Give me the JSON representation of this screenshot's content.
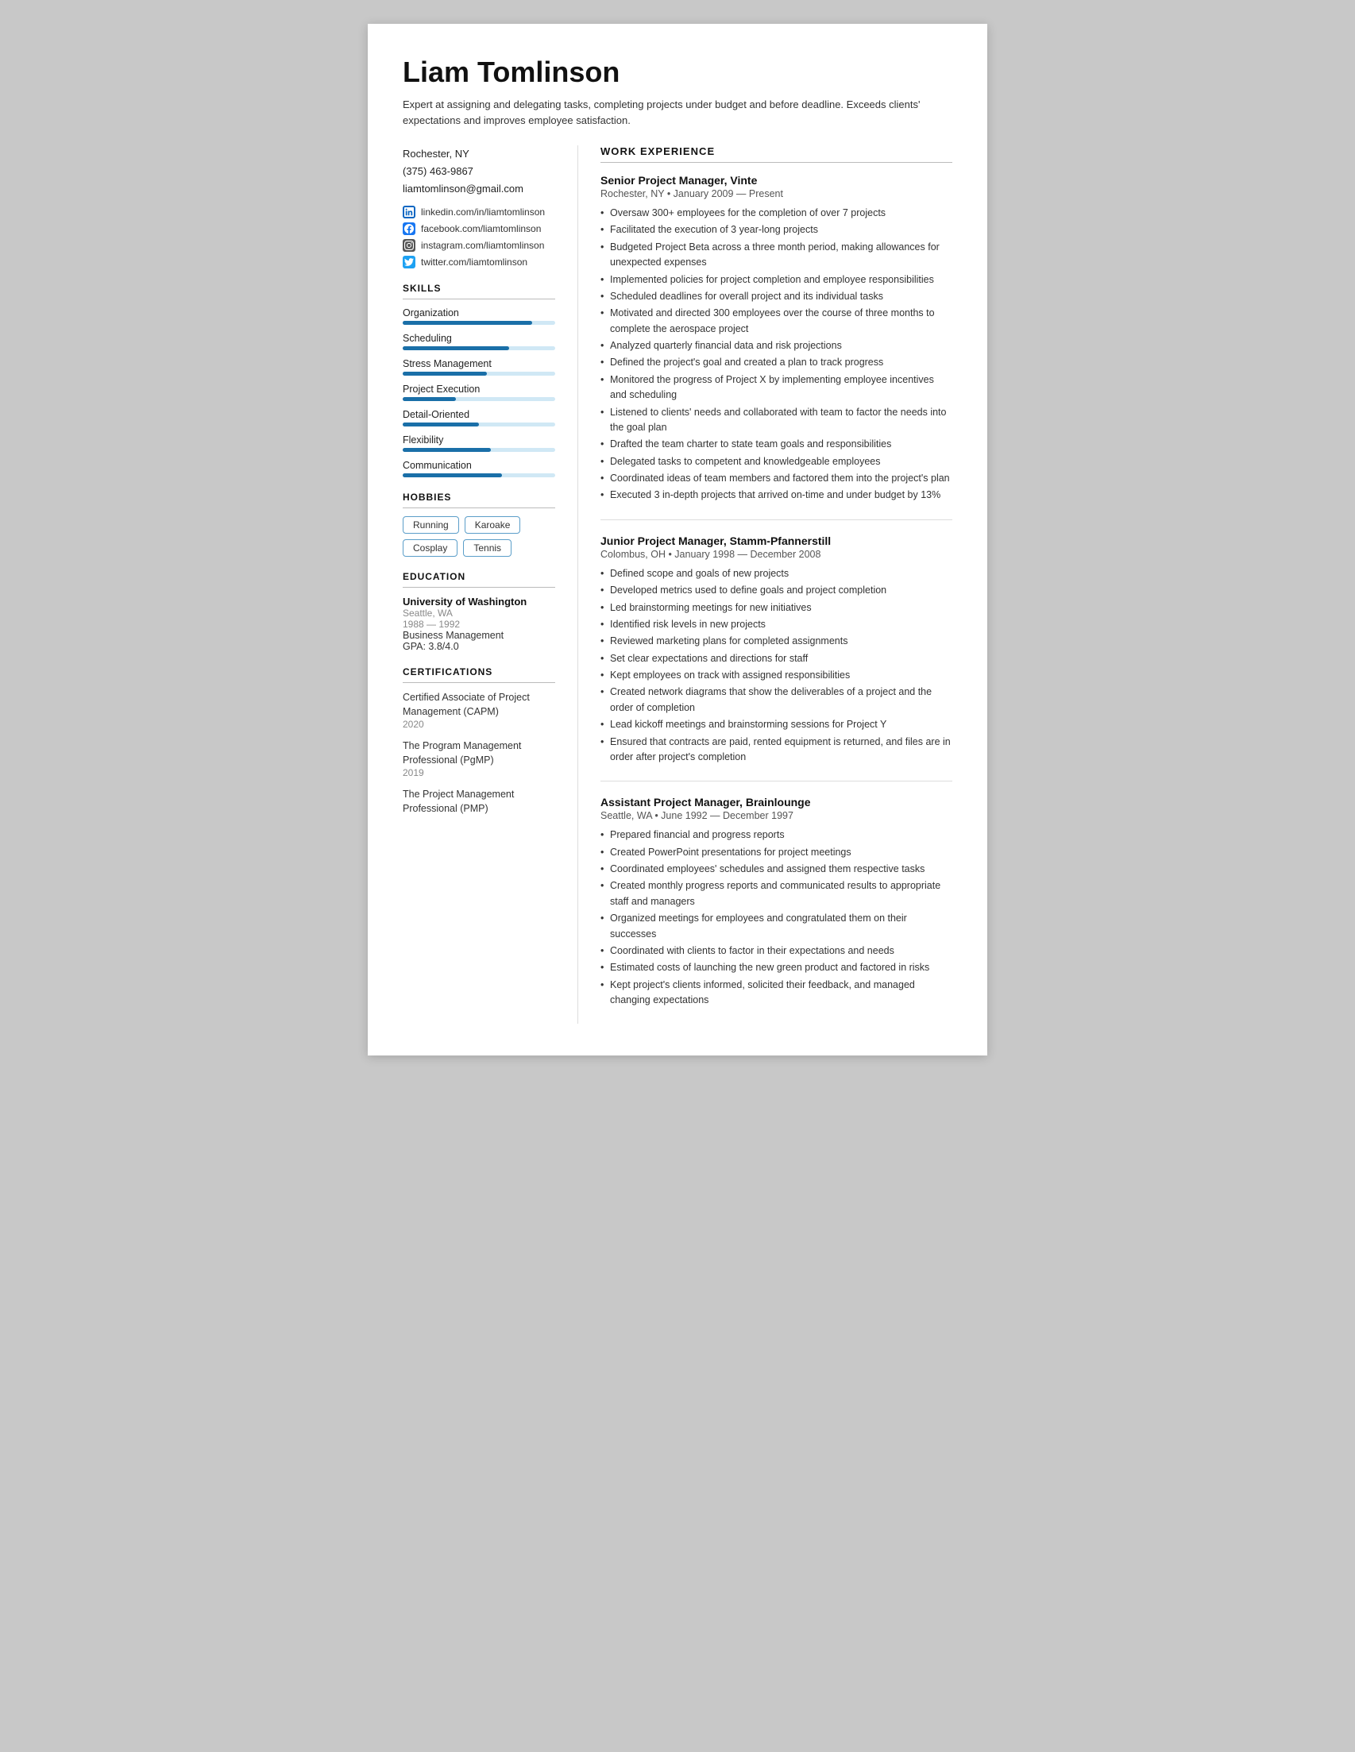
{
  "header": {
    "name": "Liam Tomlinson",
    "summary": "Expert at assigning and delegating tasks, completing projects under budget and before deadline. Exceeds clients' expectations and improves employee satisfaction."
  },
  "contact": {
    "location": "Rochester, NY",
    "phone": "(375) 463-9867",
    "email": "liamtomlinson@gmail.com",
    "social": [
      {
        "platform": "linkedin",
        "url": "linkedin.com/in/liamtomlinson",
        "icon": "linkedin"
      },
      {
        "platform": "facebook",
        "url": "facebook.com/liamtomlinson",
        "icon": "facebook"
      },
      {
        "platform": "instagram",
        "url": "instagram.com/liamtomlinson",
        "icon": "instagram"
      },
      {
        "platform": "twitter",
        "url": "twitter.com/liamtomlinson",
        "icon": "twitter"
      }
    ]
  },
  "skills": {
    "section_title": "SKILLS",
    "items": [
      {
        "name": "Organization",
        "level": 85
      },
      {
        "name": "Scheduling",
        "level": 70
      },
      {
        "name": "Stress Management",
        "level": 55
      },
      {
        "name": "Project Execution",
        "level": 35
      },
      {
        "name": "Detail-Oriented",
        "level": 50
      },
      {
        "name": "Flexibility",
        "level": 58
      },
      {
        "name": "Communication",
        "level": 65
      }
    ]
  },
  "hobbies": {
    "section_title": "HOBBIES",
    "items": [
      "Running",
      "Karoake",
      "Cosplay",
      "Tennis"
    ]
  },
  "education": {
    "section_title": "EDUCATION",
    "items": [
      {
        "name": "University of Washington",
        "location": "Seattle, WA",
        "years": "1988 — 1992",
        "degree": "Business Management",
        "gpa": "GPA: 3.8/4.0"
      }
    ]
  },
  "certifications": {
    "section_title": "CERTIFICATIONS",
    "items": [
      {
        "name": "Certified Associate of Project Management (CAPM)",
        "year": "2020"
      },
      {
        "name": "The Program Management Professional (PgMP)",
        "year": "2019"
      },
      {
        "name": "The Project Management Professional (PMP)",
        "year": ""
      }
    ]
  },
  "work_experience": {
    "section_title": "WORK EXPERIENCE",
    "jobs": [
      {
        "title": "Senior Project Manager, Vinte",
        "meta": "Rochester, NY • January 2009 — Present",
        "bullets": [
          "Oversaw 300+ employees for the completion of over 7 projects",
          "Facilitated the execution of 3 year-long projects",
          "Budgeted Project Beta across a three month period, making allowances for unexpected expenses",
          "Implemented policies for project completion and employee responsibilities",
          "Scheduled deadlines for overall project and its individual tasks",
          "Motivated and directed 300 employees over the course of three months to complete the aerospace project",
          "Analyzed quarterly financial data and risk projections",
          "Defined the project's goal and created a plan to track progress",
          "Monitored the progress of Project X by implementing employee incentives and scheduling",
          "Listened to clients' needs and collaborated with team to factor the needs into the goal plan",
          "Drafted the team charter to state team goals and responsibilities",
          "Delegated tasks to competent and knowledgeable employees",
          "Coordinated ideas of team members and factored them into the project's plan",
          "Executed 3 in-depth projects that arrived on-time and under budget by 13%"
        ]
      },
      {
        "title": "Junior Project Manager, Stamm-Pfannerstill",
        "meta": "Colombus, OH • January 1998 — December 2008",
        "bullets": [
          "Defined scope and goals of new projects",
          "Developed metrics used to define goals and project completion",
          "Led brainstorming meetings for new initiatives",
          "Identified risk levels in new projects",
          "Reviewed marketing plans for completed assignments",
          "Set clear expectations and directions for staff",
          "Kept employees on track with assigned responsibilities",
          "Created network diagrams that show the deliverables of a project and the order of completion",
          "Lead kickoff meetings and brainstorming sessions for Project Y",
          "Ensured that contracts are paid, rented equipment is returned, and files are in order after project's completion"
        ]
      },
      {
        "title": "Assistant Project Manager, Brainlounge",
        "meta": "Seattle, WA • June 1992 — December 1997",
        "bullets": [
          "Prepared financial and progress reports",
          "Created PowerPoint presentations for project meetings",
          "Coordinated employees' schedules and assigned them respective tasks",
          "Created monthly progress reports and communicated results to appropriate staff and managers",
          "Organized meetings for employees and congratulated them on their successes",
          "Coordinated with clients to factor in their expectations and needs",
          "Estimated costs of launching the new green product and factored in risks",
          "Kept project's clients informed, solicited their feedback, and managed changing expectations"
        ]
      }
    ]
  }
}
